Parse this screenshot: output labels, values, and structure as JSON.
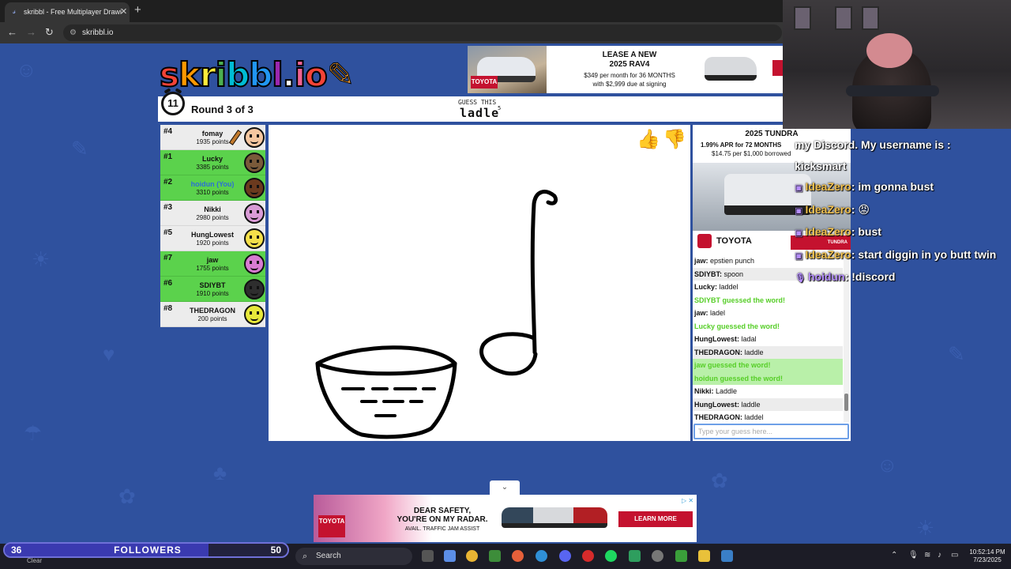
{
  "browser": {
    "tab_title": "skribbl - Free Multiplayer Drawi",
    "url": "skribbl.io"
  },
  "logo": {
    "letters": [
      "s",
      "k",
      "r",
      "i",
      "b",
      "b",
      "l",
      ".",
      "i",
      "o"
    ],
    "colors": [
      "#f44336",
      "#ff9800",
      "#ffeb3b",
      "#4caf50",
      "#00bcd4",
      "#2196f3",
      "#9c27b0",
      "#ffffff",
      "#f06292",
      "#f44336"
    ]
  },
  "ad_top": {
    "brand": "TOYOTA",
    "headline": "LEASE A NEW\n2025 RAV4",
    "line1": "$349 per month for 36 MONTHS",
    "line2": "with $2,999 due at signing"
  },
  "game": {
    "timer": "11",
    "round": "Round 3 of 3",
    "guess_label": "GUESS THIS",
    "word": "ladle",
    "word_count": "5"
  },
  "players": [
    {
      "rank": "#4",
      "name": "fomay",
      "points": "1935 points",
      "guessed": false,
      "you": false,
      "drawing": true,
      "color": "#f6c7a0"
    },
    {
      "rank": "#1",
      "name": "Lucky",
      "points": "3385 points",
      "guessed": true,
      "you": false,
      "drawing": false,
      "color": "#7a5a3a"
    },
    {
      "rank": "#2",
      "name": "hoidun (You)",
      "points": "3310 points",
      "guessed": true,
      "you": true,
      "drawing": false,
      "color": "#6b3a1e"
    },
    {
      "rank": "#3",
      "name": "Nikki",
      "points": "2980 points",
      "guessed": false,
      "you": false,
      "drawing": false,
      "color": "#d99bd6"
    },
    {
      "rank": "#5",
      "name": "HungLowest",
      "points": "1920 points",
      "guessed": false,
      "you": false,
      "drawing": false,
      "color": "#f5e04a"
    },
    {
      "rank": "#7",
      "name": "jaw",
      "points": "1755 points",
      "guessed": true,
      "you": false,
      "drawing": false,
      "color": "#d77bd1"
    },
    {
      "rank": "#6",
      "name": "SDIYBT",
      "points": "1910 points",
      "guessed": true,
      "you": false,
      "drawing": false,
      "color": "#2e2e2e"
    },
    {
      "rank": "#8",
      "name": "THEDRAGON",
      "points": "200 points",
      "guessed": false,
      "you": false,
      "drawing": false,
      "color": "#e7e83a"
    }
  ],
  "chat_ad": {
    "title": "2025 TUNDRA",
    "apr": "1.99% APR for 72 MONTHS",
    "rate": "$14.75 per $1,000 borrowed",
    "brand": "TOYOTA",
    "tag": "TUNDRA"
  },
  "chat": {
    "messages": [
      {
        "user": "jaw",
        "text": "epstien punch",
        "type": "normal"
      },
      {
        "user": "SDIYBT",
        "text": "spoon",
        "type": "normal"
      },
      {
        "user": "Lucky",
        "text": "laddel",
        "type": "normal"
      },
      {
        "user": "",
        "text": "SDIYBT guessed the word!",
        "type": "guess"
      },
      {
        "user": "jaw",
        "text": "ladel",
        "type": "normal"
      },
      {
        "user": "",
        "text": "Lucky guessed the word!",
        "type": "guess"
      },
      {
        "user": "HungLowest",
        "text": "ladal",
        "type": "normal"
      },
      {
        "user": "THEDRAGON",
        "text": "laddle",
        "type": "normal"
      },
      {
        "user": "",
        "text": "jaw guessed the word!",
        "type": "guess-hl"
      },
      {
        "user": "",
        "text": "hoidun guessed the word!",
        "type": "guess-hl"
      },
      {
        "user": "Nikki",
        "text": "Laddle",
        "type": "normal"
      },
      {
        "user": "HungLowest",
        "text": "laddle",
        "type": "normal"
      },
      {
        "user": "THEDRAGON",
        "text": "laddel",
        "type": "normal"
      }
    ],
    "input_placeholder": "Type your guess here..."
  },
  "ad_bottom": {
    "brand": "TOYOTA",
    "headline": "DEAR SAFETY,\nYOU'RE ON MY RADAR.",
    "sub": "AVAIL. TRAFFIC JAM ASSIST",
    "cta": "LEARN MORE"
  },
  "stream_chat": [
    {
      "user": "",
      "text": "my Discord. My username is :"
    },
    {
      "user": "",
      "text": "kicksmart"
    },
    {
      "user": "IdeaZero",
      "text": ": im gonna bust"
    },
    {
      "user": "IdeaZero",
      "text": ": 😡"
    },
    {
      "user": "IdeaZero",
      "text": ": bust"
    },
    {
      "user": "IdeaZero",
      "text": ": start diggin in yo butt twin"
    },
    {
      "user": "hoidun",
      "text": ": !discord"
    }
  ],
  "followers": {
    "current": "36",
    "label": "FOLLOWERS",
    "goal": "50",
    "progress": 0.72
  },
  "taskbar": {
    "weather": "Clear",
    "search": "Search",
    "time": "10:52:14 PM",
    "date": "7/23/2025"
  }
}
